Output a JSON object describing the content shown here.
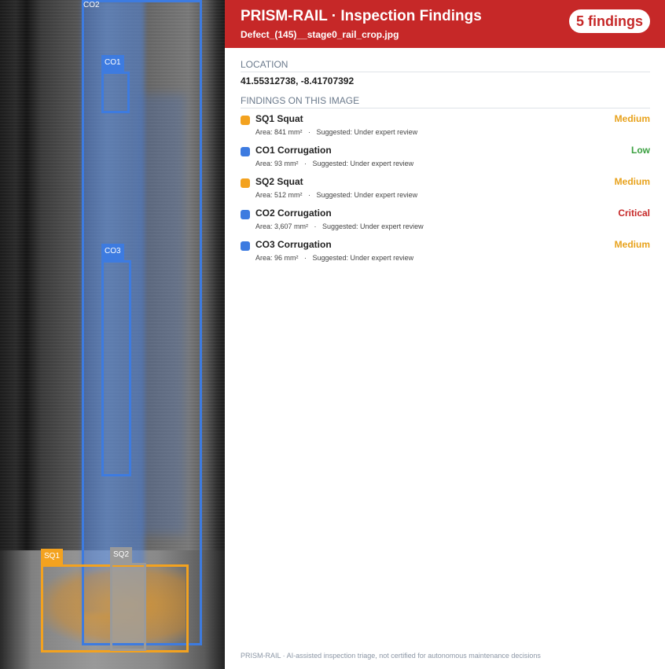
{
  "header": {
    "title": "PRISM-RAIL · Inspection Findings",
    "filename": "Defect_(145)__stage0_rail_crop.jpg",
    "count_badge": "5 findings"
  },
  "location": {
    "heading": "LOCATION",
    "value": "41.55312738, -8.41707392"
  },
  "findings_heading": "FINDINGS ON THIS IMAGE",
  "colors": {
    "squat": "#f3a21f",
    "corrugation": "#3d7be0",
    "medium": "#e8a21c",
    "low": "#3aa040",
    "critical": "#c62828",
    "header": "#c62828"
  },
  "findings": [
    {
      "id": "SQ1",
      "type": "Squat",
      "label": "SQ1  Squat",
      "area": "841 mm²",
      "suggested": "Under expert review",
      "severity": "Medium",
      "meta": "Area: 841 mm²   ·   Suggested: Under expert review"
    },
    {
      "id": "CO1",
      "type": "Corrugation",
      "label": "CO1  Corrugation",
      "area": "93 mm²",
      "suggested": "Under expert review",
      "severity": "Low",
      "meta": "Area: 93 mm²   ·   Suggested: Under expert review"
    },
    {
      "id": "SQ2",
      "type": "Squat",
      "label": "SQ2  Squat",
      "area": "512 mm²",
      "suggested": "Under expert review",
      "severity": "Medium",
      "meta": "Area: 512 mm²   ·   Suggested: Under expert review"
    },
    {
      "id": "CO2",
      "type": "Corrugation",
      "label": "CO2  Corrugation",
      "area": "3,607 mm²",
      "suggested": "Under expert review",
      "severity": "Critical",
      "meta": "Area: 3,607 mm²   ·   Suggested: Under expert review"
    },
    {
      "id": "CO3",
      "type": "Corrugation",
      "label": "CO3  Corrugation",
      "area": "96 mm²",
      "suggested": "Under expert review",
      "severity": "Medium",
      "meta": "Area: 96 mm²   ·   Suggested: Under expert review"
    }
  ],
  "image_tags": {
    "co2": "CO2",
    "co1": "CO1",
    "co3": "CO3",
    "sq1": "SQ1",
    "sq2": "SQ2"
  },
  "footer": "PRISM-RAIL · AI-assisted inspection triage, not certified for autonomous maintenance decisions"
}
